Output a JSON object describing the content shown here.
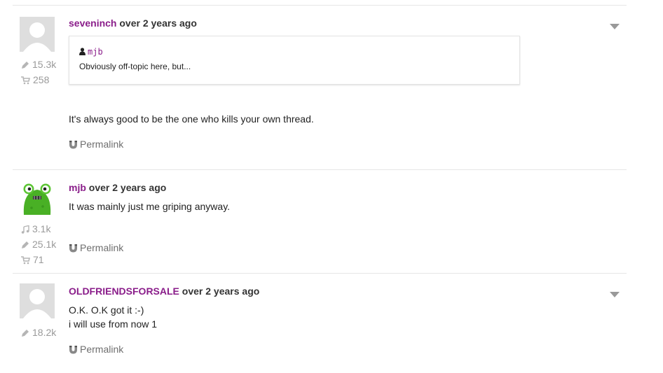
{
  "comments": [
    {
      "username": "seveninch",
      "time": "over 2 years ago",
      "quote": {
        "author": "mjb",
        "text": "Obviously off-topic here, but..."
      },
      "lines": [
        "It's always good to be the one who kills your own thread."
      ],
      "stats": [
        {
          "icon": "pencil-icon",
          "value": "15.3k"
        },
        {
          "icon": "cart-icon",
          "value": "258"
        }
      ],
      "permalink": "Permalink",
      "has_menu": true
    },
    {
      "username": "mjb",
      "time": "over 2 years ago",
      "lines": [
        "It was mainly just me griping anyway."
      ],
      "stats": [
        {
          "icon": "music-note-icon",
          "value": "3.1k"
        },
        {
          "icon": "pencil-icon",
          "value": "25.1k"
        },
        {
          "icon": "cart-icon",
          "value": "71"
        }
      ],
      "permalink": "Permalink",
      "has_menu": false
    },
    {
      "username": "OLDFRIENDSFORSALE",
      "time": "over 2 years ago",
      "lines": [
        "O.K. O.K got it :-)",
        "i will use from now 1"
      ],
      "stats": [
        {
          "icon": "pencil-icon",
          "value": "18.2k"
        }
      ],
      "permalink": "Permalink",
      "has_menu": true
    }
  ],
  "colors": {
    "username": "#8a1d8a",
    "stat": "#9a9a9a",
    "divider": "#e6e6e6",
    "avatar_bg": "#dedede"
  }
}
